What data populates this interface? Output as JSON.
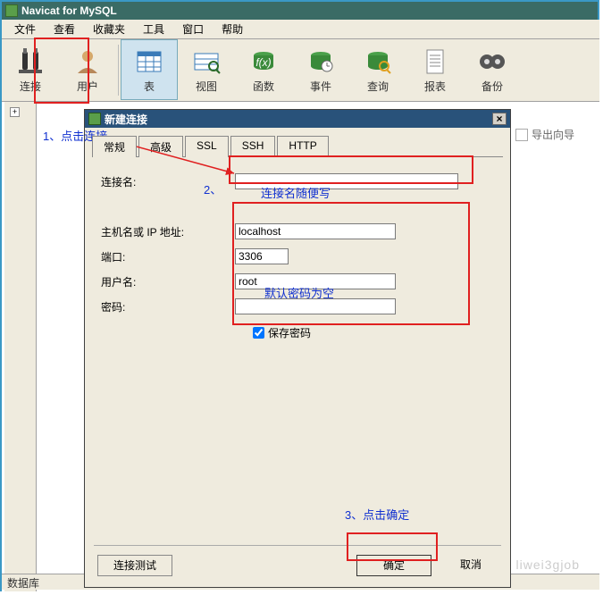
{
  "window": {
    "title": "Navicat for MySQL"
  },
  "menu": {
    "file": "文件",
    "view": "查看",
    "fav": "收藏夹",
    "tools": "工具",
    "window": "窗口",
    "help": "帮助"
  },
  "toolbar": {
    "connect": "连接",
    "user": "用户",
    "table": "表",
    "view": "视图",
    "func": "函数",
    "event": "事件",
    "query": "查询",
    "report": "报表",
    "backup": "备份"
  },
  "right": {
    "export": "导出向导"
  },
  "dialog": {
    "title": "新建连接",
    "tabs": {
      "general": "常规",
      "advanced": "高级",
      "ssl": "SSL",
      "ssh": "SSH",
      "http": "HTTP"
    },
    "labels": {
      "conn_name": "连接名:",
      "host": "主机名或 IP 地址:",
      "port": "端口:",
      "user": "用户名:",
      "pass": "密码:",
      "savepass": "保存密码"
    },
    "values": {
      "conn_name": "",
      "host": "localhost",
      "port": "3306",
      "user": "root",
      "pass": ""
    },
    "buttons": {
      "test": "连接测试",
      "ok": "确定",
      "cancel": "取消"
    }
  },
  "annotations": {
    "a1": "1、点击连接",
    "a2num": "2、",
    "a2": "连接名随便写",
    "a3": "默认密码为空",
    "a4": "3、点击确定"
  },
  "status": "数据库",
  "watermark": "liwei3gjob"
}
